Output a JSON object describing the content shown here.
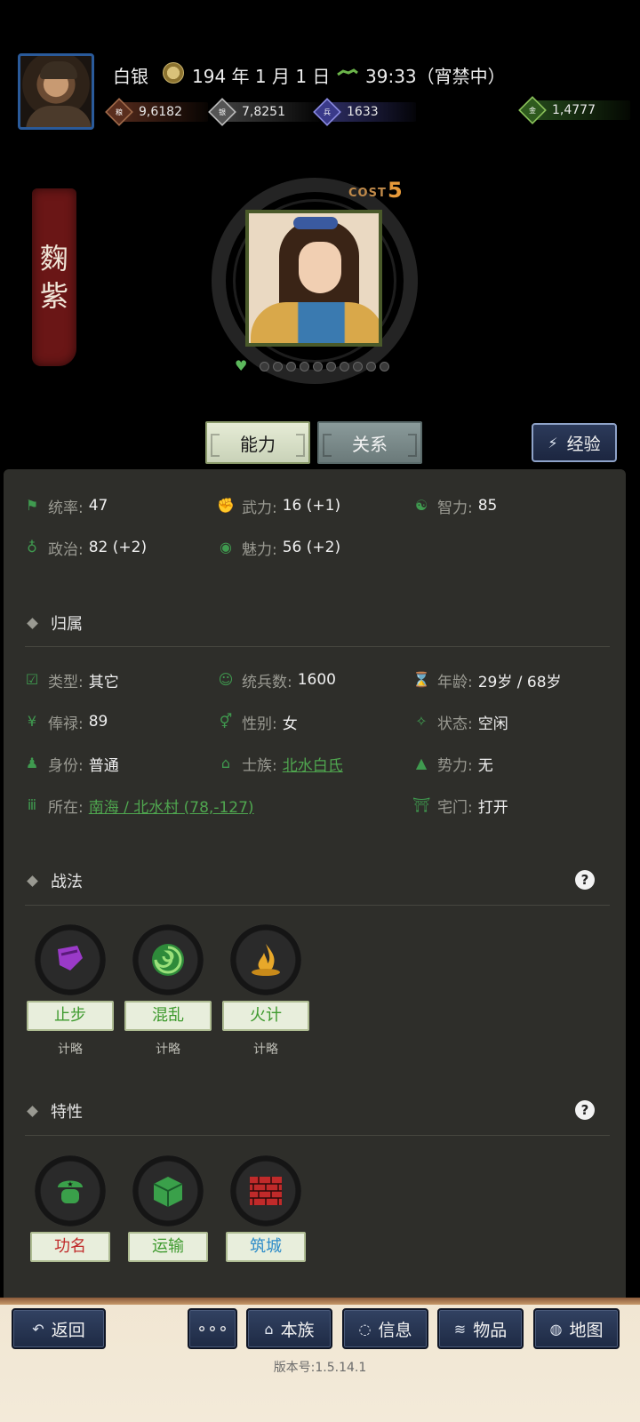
{
  "header": {
    "currency_name": "白银",
    "date": "194 年 1 月 1 日",
    "clock": "39:33（宵禁中）",
    "resources": {
      "food": "9,6182",
      "silver": "7,8251",
      "troops": "1633",
      "gold": "1,4777"
    }
  },
  "character": {
    "name_char1": "麴",
    "name_char2": "紫",
    "cost_label": "COST",
    "cost_value": "5",
    "bond_dots": 10
  },
  "tabs": {
    "ability": "能力",
    "relation": "关系",
    "experience": "经验"
  },
  "stats": {
    "command": {
      "label": "统率:",
      "value": "47"
    },
    "force": {
      "label": "武力:",
      "value": "16 (+1)"
    },
    "intellect": {
      "label": "智力:",
      "value": "85"
    },
    "politics": {
      "label": "政治:",
      "value": "82 (+2)"
    },
    "charm": {
      "label": "魅力:",
      "value": "56 (+2)"
    }
  },
  "affiliation": {
    "title": "归属",
    "type": {
      "label": "类型:",
      "value": "其它"
    },
    "troops": {
      "label": "统兵数:",
      "value": "1600"
    },
    "age": {
      "label": "年龄:",
      "value": "29岁 / 68岁"
    },
    "salary": {
      "label": "俸禄:",
      "value": "89"
    },
    "gender": {
      "label": "性别:",
      "value": "女"
    },
    "status": {
      "label": "状态:",
      "value": "空闲"
    },
    "identity": {
      "label": "身份:",
      "value": "普通"
    },
    "clan": {
      "label": "士族:",
      "value": "北水白氏"
    },
    "faction": {
      "label": "势力:",
      "value": "无"
    },
    "location": {
      "label": "所在:",
      "value": "南海 / 北水村 (78,-127)"
    },
    "residence": {
      "label": "宅门:",
      "value": "打开"
    }
  },
  "tactics": {
    "title": "战法",
    "items": [
      {
        "name": "止步",
        "type": "计略",
        "color": "#8a3ab0"
      },
      {
        "name": "混乱",
        "type": "计略",
        "color": "#3aa04a"
      },
      {
        "name": "火计",
        "type": "计略",
        "color": "#d89a2a"
      }
    ]
  },
  "traits": {
    "title": "特性",
    "items": [
      {
        "name": "功名"
      },
      {
        "name": "运输"
      },
      {
        "name": "筑城"
      }
    ]
  },
  "bottom_nav": {
    "back": "返回",
    "more": "∘∘∘",
    "clan": "本族",
    "info": "信息",
    "items": "物品",
    "map": "地图"
  },
  "version": "版本号:1.5.14.1"
}
